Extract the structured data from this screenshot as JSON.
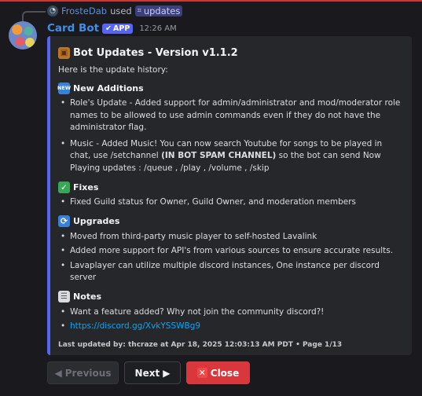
{
  "command": {
    "user": "FrosteDab",
    "used_text": "used",
    "command_name": "updates"
  },
  "author": {
    "name": "Card Bot",
    "badge": "APP",
    "time": "12:26 AM"
  },
  "embed": {
    "accent_color": "#5865f2",
    "title": "Bot Updates - Version v1.1.2",
    "description": "Here is the update history:",
    "sections": {
      "additions": {
        "heading": "New Additions",
        "items": [
          "Role's Update - Added support for admin/administrator and mod/moderator role names to be allowed to use admin commands even if they do not have the administrator flag.",
          "Music - Added Music! You can now search Youtube for songs to be played in chat, use /setchannel ",
          "(IN BOT SPAM CHANNEL)",
          " so the bot can send Now Playing updates : /queue , /play , /volume , /skip"
        ]
      },
      "fixes": {
        "heading": "Fixes",
        "items": [
          "Fixed Guild status for Owner, Guild Owner, and moderation members"
        ]
      },
      "upgrades": {
        "heading": "Upgrades",
        "items": [
          "Moved from third-party music player to self-hosted Lavalink",
          "Added more support for API's from various sources to ensure accurate results.",
          "Lavaplayer can utilize multiple discord instances, One instance per discord server"
        ]
      },
      "notes": {
        "heading": "Notes",
        "items": [
          "Want a feature added? Why not join the community discord?!"
        ],
        "link": "https://discord.gg/XvkYSSWBg9"
      }
    },
    "footer": "Last updated by: thcraze at Apr 18, 2025 12:03:13 AM PDT • Page 1/13"
  },
  "buttons": {
    "previous": "Previous",
    "next": "Next",
    "close": "Close"
  },
  "colors": {
    "author_name": "#3f8ee8",
    "close_button": "#da373c",
    "link": "#00a8fc"
  }
}
